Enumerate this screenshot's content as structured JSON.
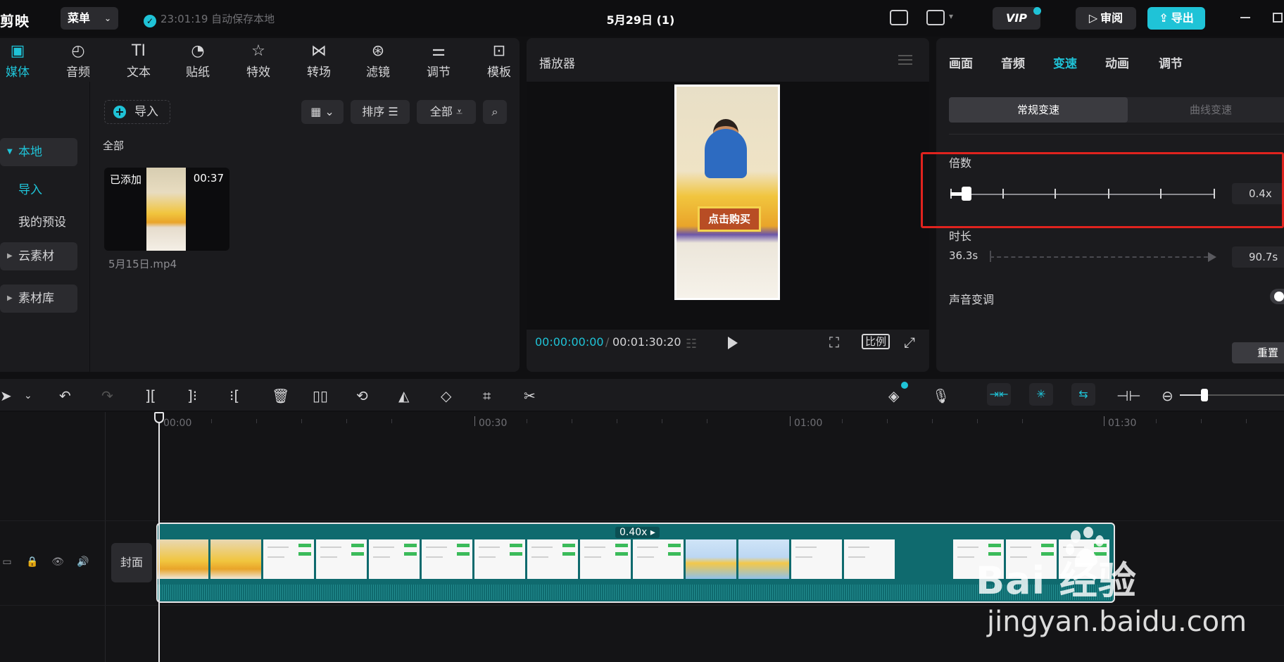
{
  "app": {
    "logo": "剪映",
    "menu_label": "菜单",
    "autosave": "23:01:19 自动保存本地",
    "title": "5月29日 (1)",
    "vip_label": "VIP",
    "review_label": "审阅",
    "export_label": "导出"
  },
  "media": {
    "tabs": [
      {
        "label": "媒体",
        "icon": "media-icon"
      },
      {
        "label": "音频",
        "icon": "audio-icon"
      },
      {
        "label": "文本",
        "icon": "text-icon"
      },
      {
        "label": "贴纸",
        "icon": "sticker-icon"
      },
      {
        "label": "特效",
        "icon": "effects-icon"
      },
      {
        "label": "转场",
        "icon": "transition-icon"
      },
      {
        "label": "滤镜",
        "icon": "filter-icon"
      },
      {
        "label": "调节",
        "icon": "adjust-icon"
      },
      {
        "label": "模板",
        "icon": "template-icon"
      }
    ],
    "sidebar": {
      "local": "本地",
      "import": "导入",
      "presets": "我的预设",
      "cloud": "云素材",
      "library": "素材库"
    },
    "import_button": "导入",
    "sort_label": "排序",
    "filter_label": "全部",
    "section_label": "全部",
    "clip": {
      "status": "已添加",
      "duration": "00:37",
      "filename": "5月15日.mp4"
    }
  },
  "player": {
    "title": "播放器",
    "current_time": "00:00:00:00",
    "separator": "/",
    "total_time": "00:01:30:20",
    "ratio_label": "比例",
    "preview_button": "点击购买"
  },
  "inspector": {
    "tabs": [
      "画面",
      "音频",
      "变速",
      "动画",
      "调节"
    ],
    "active_tab": "变速",
    "speed_modes": [
      "常规变速",
      "曲线变速"
    ],
    "multiplier_label": "倍数",
    "multiplier_value": "0.4x",
    "duration_label": "时长",
    "duration_from": "36.3s",
    "duration_to": "90.7s",
    "pitch_label": "声音变调",
    "reset_label": "重置"
  },
  "timeline": {
    "ruler": [
      "00:00",
      "00:30",
      "01:00",
      "01:30"
    ],
    "cover_label": "封面",
    "clip_speed": "0.40x"
  },
  "watermark": {
    "brand": "Bai  经验",
    "url": "jingyan.baidu.com"
  },
  "colors": {
    "accent": "#1fc3d7",
    "highlight": "#e0231e",
    "clip": "#0f6a6e"
  }
}
